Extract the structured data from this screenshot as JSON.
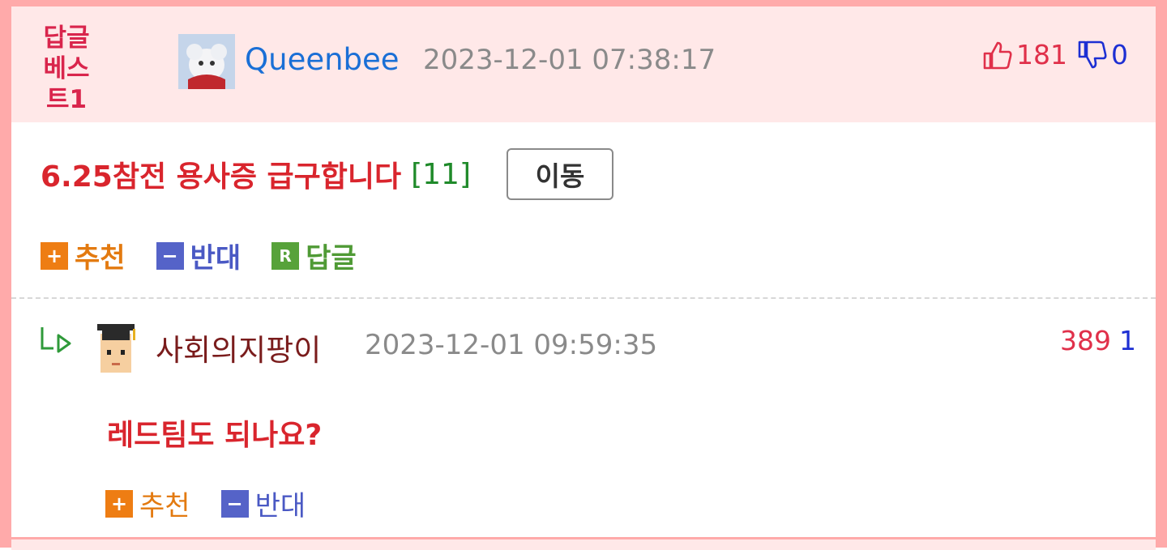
{
  "post": {
    "badge_line1": "답글",
    "badge_line2": "베스트1",
    "username": "Queenbee",
    "datetime": "2023-12-01 07:38:17",
    "upvotes": "181",
    "downvotes": "0",
    "title": "6.25참전 용사증 급구합니다",
    "comment_count": "[11]",
    "move_label": "이동",
    "actions": {
      "recommend": "추천",
      "oppose": "반대",
      "reply": "답글"
    },
    "icons": {
      "recommend": "+",
      "oppose": "−",
      "reply": "R"
    }
  },
  "reply": {
    "username": "사회의지팡이",
    "datetime": "2023-12-01 09:59:35",
    "upvotes": "389",
    "downvotes": "1",
    "text": "레드팀도 되나요?",
    "actions": {
      "recommend": "추천",
      "oppose": "반대"
    }
  },
  "colors": {
    "accent_red": "#d9252d",
    "link_blue": "#1a6fd6",
    "border_pink": "#ffaaaa",
    "header_bg": "#ffe8e8"
  }
}
